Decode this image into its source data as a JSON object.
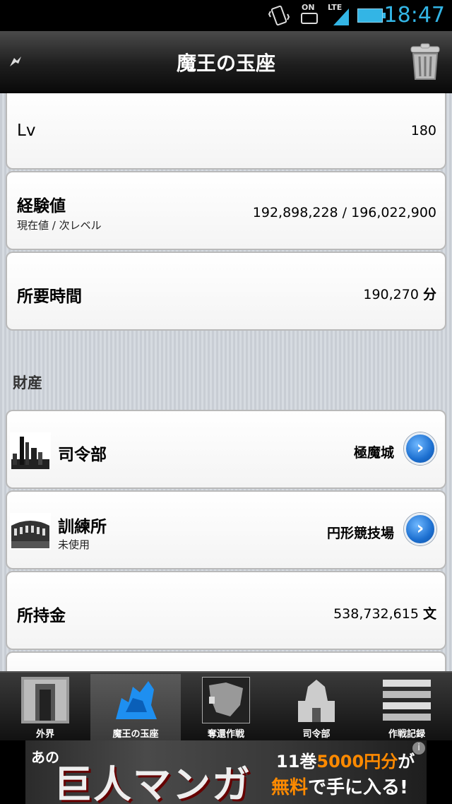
{
  "status_bar": {
    "time": "18:47",
    "network": "LTE",
    "toggle_label": "ON"
  },
  "header": {
    "title": "魔王の玉座"
  },
  "stats": {
    "level": {
      "label": "Lv",
      "value": "180"
    },
    "experience": {
      "label": "経験値",
      "sub": "現在値 / 次レベル",
      "value": "192,898,228 / 196,022,900"
    },
    "required_time": {
      "label": "所要時間",
      "value": "190,270",
      "unit": "分"
    }
  },
  "assets": {
    "section_title": "財産",
    "headquarters": {
      "label": "司令部",
      "value": "極魔城"
    },
    "training": {
      "label": "訓練所",
      "sub": "未使用",
      "value": "円形競技場"
    },
    "money": {
      "label": "所持金",
      "value": "538,732,615",
      "unit": "文"
    }
  },
  "tabs": [
    {
      "label": "外界"
    },
    {
      "label": "魔王の玉座"
    },
    {
      "label": "奪還作戦"
    },
    {
      "label": "司令部"
    },
    {
      "label": "作戦記録"
    }
  ],
  "active_tab": 1,
  "ad": {
    "prefix": "あの",
    "headline": "巨人マンガ",
    "line1_a": "11巻",
    "line1_b": "5000円分",
    "line1_c": "が",
    "line2_a": "無料",
    "line2_b": "で手に入る!"
  },
  "colors": {
    "accent": "#33b5e5",
    "button_blue": "#1c6fd0",
    "ad_highlight": "#ff8a00"
  }
}
